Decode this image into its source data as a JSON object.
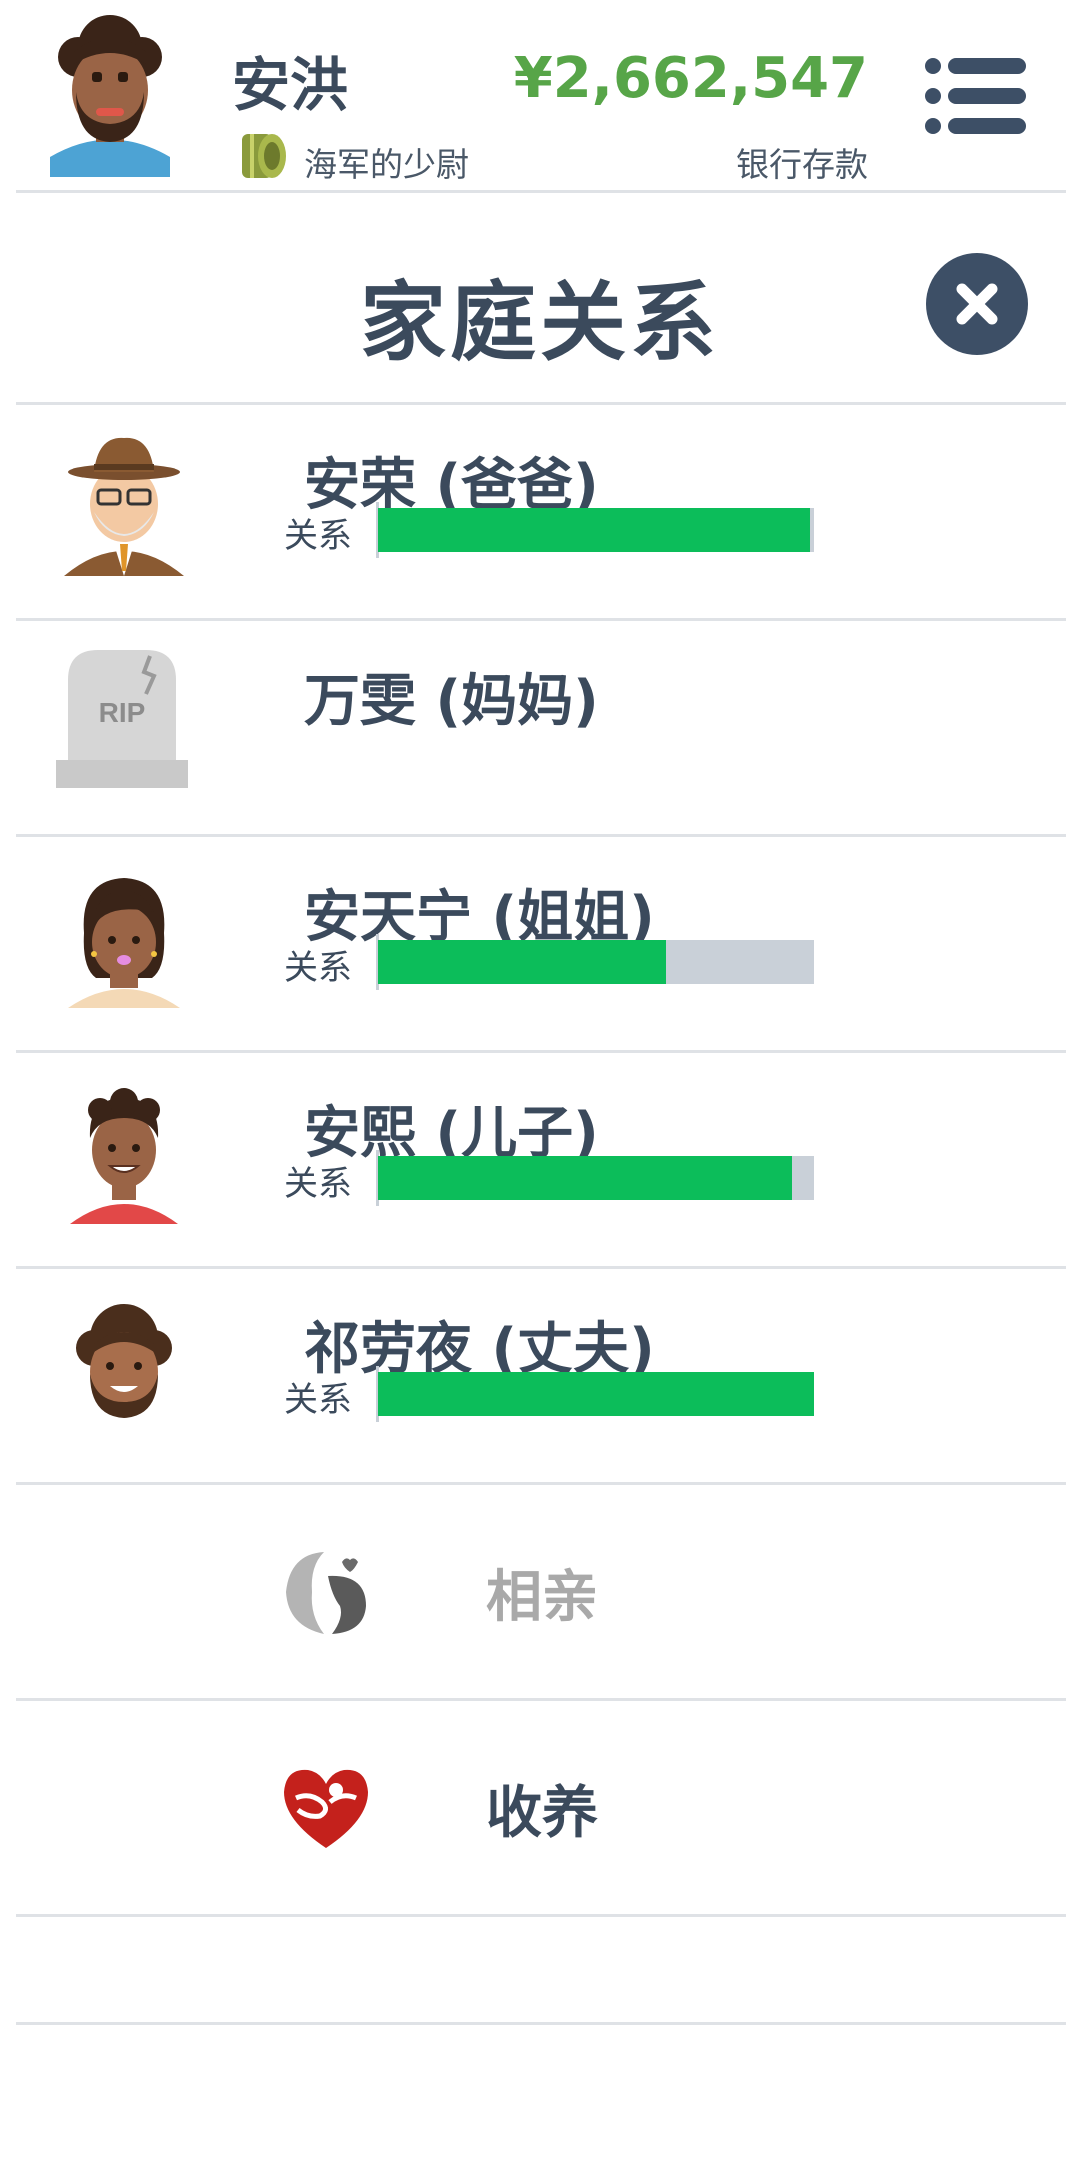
{
  "header": {
    "player_name": "安洪",
    "job_title": "海军的少尉",
    "money": "¥2,662,547",
    "bank_label": "银行存款",
    "money_color": "#57a548"
  },
  "page": {
    "title": "家庭关系"
  },
  "relationship_label": "关系",
  "family": [
    {
      "name": "安荣 (爸爸)",
      "avatar": "old-man-hat-avatar",
      "alive": true,
      "relationship": 0.99
    },
    {
      "name": "万雯 (妈妈)",
      "avatar": "rip-tombstone-icon",
      "alive": false,
      "tombstone_text": "RIP"
    },
    {
      "name": "安天宁 (姐姐)",
      "avatar": "woman-avatar",
      "alive": true,
      "relationship": 0.66
    },
    {
      "name": "安熙 (儿子)",
      "avatar": "boy-avatar",
      "alive": true,
      "relationship": 0.95
    },
    {
      "name": "祁劳夜 (丈夫)",
      "avatar": "bearded-man-avatar",
      "alive": true,
      "relationship": 1.0
    }
  ],
  "actions": [
    {
      "label": "相亲",
      "icon": "dating-couple-icon",
      "enabled": false
    },
    {
      "label": "收养",
      "icon": "adoption-heart-icon",
      "enabled": true
    }
  ],
  "colors": {
    "bar_fill": "#0cbd5a",
    "bar_track": "#c9d0d8",
    "text_dark": "#3b4a5c",
    "disabled_text": "#a9a9a9"
  }
}
